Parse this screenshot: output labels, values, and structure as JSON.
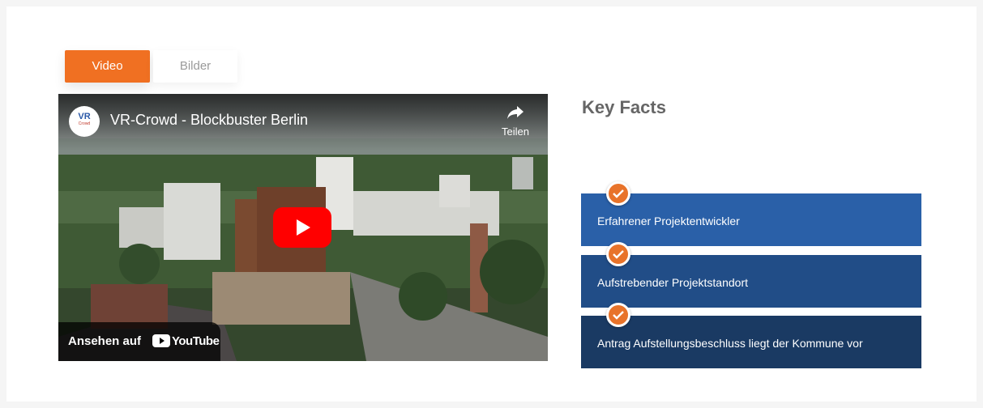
{
  "tabs": [
    {
      "label": "Video",
      "active": true
    },
    {
      "label": "Bilder",
      "active": false
    }
  ],
  "video": {
    "channel_logo": {
      "line1": "VR",
      "line2": "Crowd"
    },
    "title": "VR-Crowd - Blockbuster Berlin",
    "share_label": "Teilen",
    "watch_label": "Ansehen auf",
    "platform": "YouTube",
    "icons": [
      "share-icon",
      "play-icon",
      "youtube-logo-icon"
    ]
  },
  "key_facts": {
    "title": "Key Facts",
    "items": [
      {
        "text": "Erfahrener Projektentwickler",
        "bg": "#2a60a8"
      },
      {
        "text": "Aufstrebender Projektstandort",
        "bg": "#214d87"
      },
      {
        "text": "Antrag Aufstellungsbeschluss liegt der Kommune vor",
        "bg": "#1a3a63"
      }
    ],
    "check_color": "#e8732a"
  },
  "colors": {
    "accent": "#f07022"
  }
}
